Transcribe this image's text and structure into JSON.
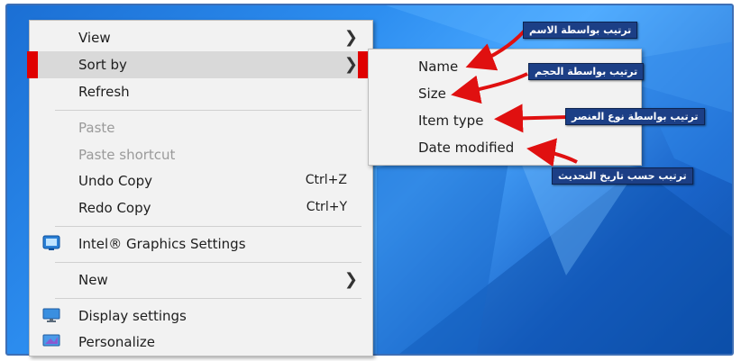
{
  "context_menu": {
    "items": [
      {
        "label": "View",
        "has_submenu": true
      },
      {
        "label": "Sort by",
        "has_submenu": true,
        "highlighted": true
      },
      {
        "label": "Refresh"
      },
      {
        "label": "Paste",
        "disabled": true
      },
      {
        "label": "Paste shortcut",
        "disabled": true
      },
      {
        "label": "Undo Copy",
        "shortcut": "Ctrl+Z"
      },
      {
        "label": "Redo Copy",
        "shortcut": "Ctrl+Y"
      },
      {
        "label": "Intel® Graphics Settings",
        "icon": "intel-graphics-icon"
      },
      {
        "label": "New",
        "has_submenu": true
      },
      {
        "label": "Display settings",
        "icon": "display-settings-icon"
      },
      {
        "label": "Personalize",
        "icon": "personalize-icon"
      }
    ]
  },
  "sort_submenu": {
    "items": [
      {
        "label": "Name"
      },
      {
        "label": "Size"
      },
      {
        "label": "Item type"
      },
      {
        "label": "Date modified"
      }
    ]
  },
  "annotations": [
    {
      "text": "ترتيب بواسطة الاسم"
    },
    {
      "text": "ترتيب بواسطة الحجم"
    },
    {
      "text": "ترتيب بواسطة نوع العنصر"
    },
    {
      "text": "ترتيب حسب تاريخ التحديث"
    }
  ],
  "colors": {
    "highlight_marker": "#e00000",
    "annotation_bg": "#1c3f86",
    "arrow": "#e01010",
    "desktop_blue": "#1b6fd4"
  }
}
